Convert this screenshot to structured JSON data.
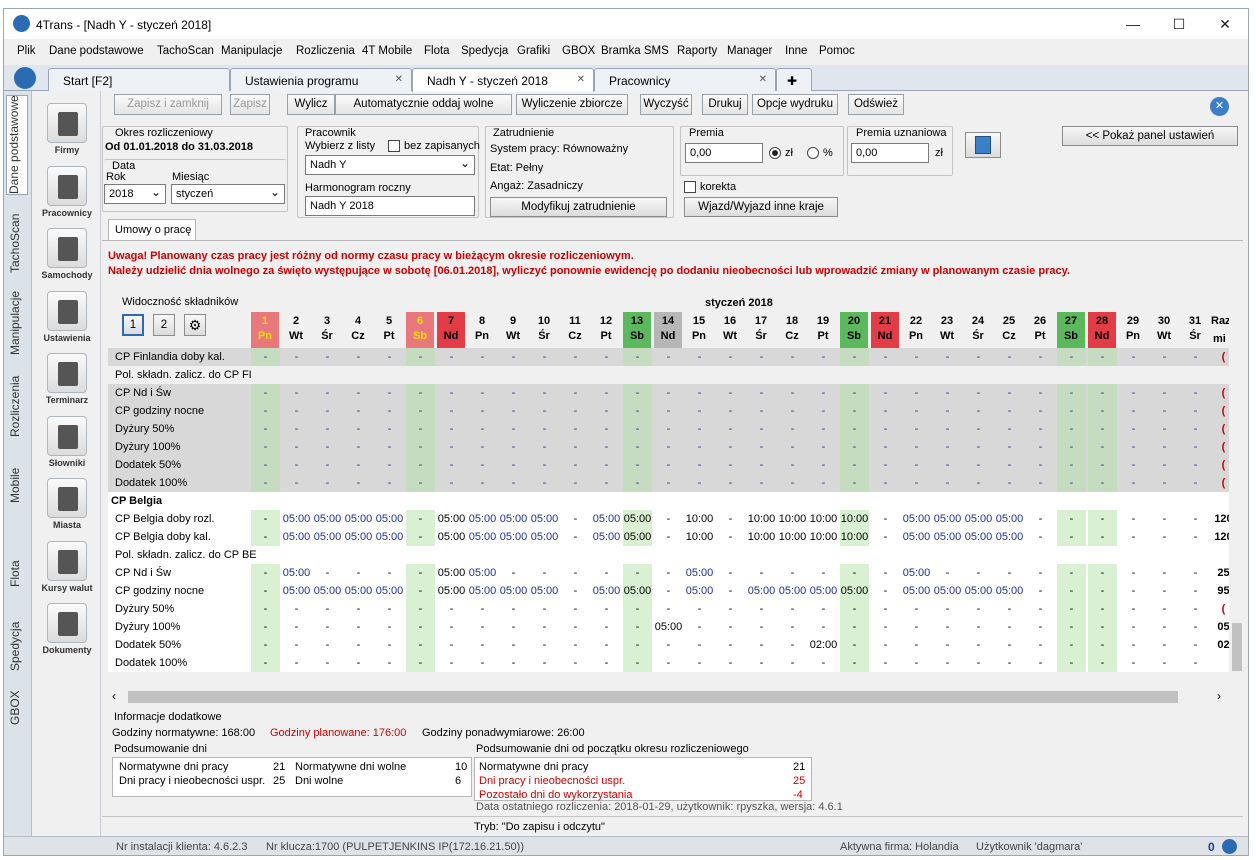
{
  "window": {
    "title": "4Trans - [Nadh Y - styczeń 2018]"
  },
  "menu": [
    "Plik",
    "Dane podstawowe",
    "TachoScan",
    "Manipulacje",
    "Rozliczenia",
    "4T Mobile",
    "Flota",
    "Spedycja",
    "Grafiki",
    "GBOX",
    "Bramka SMS",
    "Raporty",
    "Manager",
    "Inne",
    "Pomoc"
  ],
  "tabs": [
    {
      "label": "Start [F2]"
    },
    {
      "label": "Ustawienia programu"
    },
    {
      "label": "Nadh Y - styczeń 2018"
    },
    {
      "label": "Pracownicy"
    }
  ],
  "side_tabs": [
    "Dane podstawowe",
    "TachoScan",
    "Manipulacje",
    "Rozliczenia",
    "Mobile",
    "Flota",
    "Spedycja",
    "GBOX"
  ],
  "side_icons": [
    "Firmy",
    "Pracownicy",
    "Samochody",
    "Ustawienia",
    "Terminarz",
    "Słowniki",
    "Miasta",
    "Kursy walut",
    "Dokumenty"
  ],
  "toolbar": {
    "save_close": "Zapisz i zamknij",
    "save": "Zapisz",
    "compute": "Wylicz",
    "auto": "Automatycznie oddaj wolne",
    "summary": "Wyliczenie zbiorcze",
    "clear": "Wyczyść",
    "print": "Drukuj",
    "print_opts": "Opcje wydruku",
    "refresh": "Odśwież",
    "show_panel": "<< Pokaż panel ustawień"
  },
  "period": {
    "title": "Okres rozliczeniowy",
    "range": "Od  01.01.2018  do  31.03.2018",
    "data_title": "Data",
    "year_label": "Rok",
    "year": "2018",
    "month_label": "Miesiąc",
    "month": "styczeń"
  },
  "employee": {
    "title": "Pracownik",
    "choose": "Wybierz z listy",
    "without_saved": "bez zapisanych",
    "name": "Nadh Y",
    "schedule_label": "Harmonogram roczny",
    "schedule": "Nadh Y 2018"
  },
  "employment": {
    "title": "Zatrudnienie",
    "system": "System pracy: Równoważny",
    "etat": "Etat: Pełny",
    "angaz": "Angaż: Zasadniczy",
    "modify": "Modyfikuj zatrudnienie"
  },
  "bonus": {
    "title": "Premia",
    "value": "0,00",
    "zl": "zł",
    "pct": "%",
    "correction": "korekta",
    "trip": "Wjazd/Wyjazd inne kraje"
  },
  "bonus2": {
    "title": "Premia uznaniowa",
    "value": "0,00",
    "zl": "zł"
  },
  "subtab": "Umowy o pracę",
  "warnings": [
    "Uwaga! Planowany czas pracy jest różny od normy czasu pracy w bieżącym okresie rozliczeniowym.",
    "Należy udzielić dnia wolnego za święto występujące w sobotę [06.01.2018], wyliczyć ponownie ewidencję po dodaniu nieobecności lub wprowadzić zmiany w planowanym czasie pracy."
  ],
  "grid": {
    "visibility_label": "Widoczność składników",
    "month": "styczeń 2018",
    "btn1": "1",
    "btn2": "2",
    "total_top": "Raz",
    "total_bottom": "mi",
    "days": [
      {
        "n": "1",
        "d": "Pn",
        "t": "h"
      },
      {
        "n": "2",
        "d": "Wt"
      },
      {
        "n": "3",
        "d": "Śr"
      },
      {
        "n": "4",
        "d": "Cz"
      },
      {
        "n": "5",
        "d": "Pt"
      },
      {
        "n": "6",
        "d": "Sb",
        "t": "h"
      },
      {
        "n": "7",
        "d": "Nd",
        "t": "r"
      },
      {
        "n": "8",
        "d": "Pn"
      },
      {
        "n": "9",
        "d": "Wt"
      },
      {
        "n": "10",
        "d": "Śr"
      },
      {
        "n": "11",
        "d": "Cz"
      },
      {
        "n": "12",
        "d": "Pt"
      },
      {
        "n": "13",
        "d": "Sb",
        "t": "g"
      },
      {
        "n": "14",
        "d": "Nd",
        "t": "p"
      },
      {
        "n": "15",
        "d": "Pn"
      },
      {
        "n": "16",
        "d": "Wt"
      },
      {
        "n": "17",
        "d": "Śr"
      },
      {
        "n": "18",
        "d": "Cz"
      },
      {
        "n": "19",
        "d": "Pt"
      },
      {
        "n": "20",
        "d": "Sb",
        "t": "g"
      },
      {
        "n": "21",
        "d": "Nd",
        "t": "r"
      },
      {
        "n": "22",
        "d": "Pn"
      },
      {
        "n": "23",
        "d": "Wt"
      },
      {
        "n": "24",
        "d": "Śr"
      },
      {
        "n": "25",
        "d": "Cz"
      },
      {
        "n": "26",
        "d": "Pt"
      },
      {
        "n": "27",
        "d": "Sb",
        "t": "g"
      },
      {
        "n": "28",
        "d": "Nd",
        "t": "r"
      },
      {
        "n": "29",
        "d": "Pn"
      },
      {
        "n": "30",
        "d": "Wt"
      },
      {
        "n": "31",
        "d": "Śr"
      }
    ],
    "rows_fi": [
      {
        "label": "CP Finlandia doby kal.",
        "total": "(",
        "v": [
          "-",
          "-",
          "-",
          "-",
          "-",
          "-",
          "-",
          "-",
          "-",
          "-",
          "-",
          "-",
          "-",
          "-",
          "-",
          "-",
          "-",
          "-",
          "-",
          "-",
          "-",
          "-",
          "-",
          "-",
          "-",
          "-",
          "-",
          "-",
          "-",
          "-",
          "-"
        ]
      },
      {
        "label": "Pol. składn. zalicz. do CP FI",
        "section": true
      },
      {
        "label": "CP Nd i Św",
        "total": "(",
        "v": [
          "-",
          "-",
          "-",
          "-",
          "-",
          "-",
          "-",
          "-",
          "-",
          "-",
          "-",
          "-",
          "-",
          "-",
          "-",
          "-",
          "-",
          "-",
          "-",
          "-",
          "-",
          "-",
          "-",
          "-",
          "-",
          "-",
          "-",
          "-",
          "-",
          "-",
          "-"
        ]
      },
      {
        "label": "CP godziny nocne",
        "total": "(",
        "v": [
          "-",
          "-",
          "-",
          "-",
          "-",
          "-",
          "-",
          "-",
          "-",
          "-",
          "-",
          "-",
          "-",
          "-",
          "-",
          "-",
          "-",
          "-",
          "-",
          "-",
          "-",
          "-",
          "-",
          "-",
          "-",
          "-",
          "-",
          "-",
          "-",
          "-",
          "-"
        ]
      },
      {
        "label": "Dyżury 50%",
        "total": "(",
        "v": [
          "-",
          "-",
          "-",
          "-",
          "-",
          "-",
          "-",
          "-",
          "-",
          "-",
          "-",
          "-",
          "-",
          "-",
          "-",
          "-",
          "-",
          "-",
          "-",
          "-",
          "-",
          "-",
          "-",
          "-",
          "-",
          "-",
          "-",
          "-",
          "-",
          "-",
          "-"
        ]
      },
      {
        "label": "Dyżury 100%",
        "total": "(",
        "v": [
          "-",
          "-",
          "-",
          "-",
          "-",
          "-",
          "-",
          "-",
          "-",
          "-",
          "-",
          "-",
          "-",
          "-",
          "-",
          "-",
          "-",
          "-",
          "-",
          "-",
          "-",
          "-",
          "-",
          "-",
          "-",
          "-",
          "-",
          "-",
          "-",
          "-",
          "-"
        ]
      },
      {
        "label": "Dodatek 50%",
        "total": "(",
        "v": [
          "-",
          "-",
          "-",
          "-",
          "-",
          "-",
          "-",
          "-",
          "-",
          "-",
          "-",
          "-",
          "-",
          "-",
          "-",
          "-",
          "-",
          "-",
          "-",
          "-",
          "-",
          "-",
          "-",
          "-",
          "-",
          "-",
          "-",
          "-",
          "-",
          "-",
          "-"
        ]
      },
      {
        "label": "Dodatek 100%",
        "total": "(",
        "v": [
          "-",
          "-",
          "-",
          "-",
          "-",
          "-",
          "-",
          "-",
          "-",
          "-",
          "-",
          "-",
          "-",
          "-",
          "-",
          "-",
          "-",
          "-",
          "-",
          "-",
          "-",
          "-",
          "-",
          "-",
          "-",
          "-",
          "-",
          "-",
          "-",
          "-",
          "-"
        ]
      }
    ],
    "section_be": "CP Belgia",
    "rows_be": [
      {
        "label": "CP Belgia doby rozl.",
        "total": "120",
        "v": [
          "-",
          "05:00",
          "05:00",
          "05:00",
          "05:00",
          "-",
          "05:00",
          "05:00",
          "05:00",
          "05:00",
          "-",
          "05:00",
          "05:00",
          "-",
          "10:00",
          "-",
          "10:00",
          "10:00",
          "10:00",
          "10:00",
          "-",
          "05:00",
          "05:00",
          "05:00",
          "05:00",
          "-",
          "-",
          "-",
          "-",
          "-",
          "-"
        ]
      },
      {
        "label": "CP Belgia doby kal.",
        "total": "120",
        "v": [
          "-",
          "05:00",
          "05:00",
          "05:00",
          "05:00",
          "-",
          "05:00",
          "05:00",
          "05:00",
          "05:00",
          "-",
          "05:00",
          "05:00",
          "-",
          "10:00",
          "-",
          "10:00",
          "10:00",
          "10:00",
          "10:00",
          "-",
          "05:00",
          "05:00",
          "05:00",
          "05:00",
          "-",
          "-",
          "-",
          "-",
          "-",
          "-"
        ]
      },
      {
        "label": "Pol. składn. zalicz. do CP BE",
        "section": true
      },
      {
        "label": "CP Nd i Św",
        "total": "25",
        "v": [
          "-",
          "05:00",
          "-",
          "-",
          "-",
          "-",
          "05:00",
          "05:00",
          "-",
          "-",
          "-",
          "-",
          "-",
          "-",
          "05:00",
          "-",
          "-",
          "-",
          "-",
          "-",
          "-",
          "05:00",
          "-",
          "-",
          "-",
          "-",
          "-",
          "-",
          "-",
          "-",
          "-"
        ]
      },
      {
        "label": "CP godziny nocne",
        "total": "95",
        "v": [
          "-",
          "05:00",
          "05:00",
          "05:00",
          "05:00",
          "-",
          "05:00",
          "05:00",
          "05:00",
          "05:00",
          "-",
          "05:00",
          "05:00",
          "-",
          "05:00",
          "-",
          "05:00",
          "05:00",
          "05:00",
          "05:00",
          "-",
          "05:00",
          "05:00",
          "05:00",
          "05:00",
          "-",
          "-",
          "-",
          "-",
          "-",
          "-"
        ]
      },
      {
        "label": "Dyżury 50%",
        "total": "(",
        "v": [
          "-",
          "-",
          "-",
          "-",
          "-",
          "-",
          "-",
          "-",
          "-",
          "-",
          "-",
          "-",
          "-",
          "-",
          "-",
          "-",
          "-",
          "-",
          "-",
          "-",
          "-",
          "-",
          "-",
          "-",
          "-",
          "-",
          "-",
          "-",
          "-",
          "-",
          "-"
        ]
      },
      {
        "label": "Dyżury 100%",
        "total": "05",
        "v": [
          "-",
          "-",
          "-",
          "-",
          "-",
          "-",
          "-",
          "-",
          "-",
          "-",
          "-",
          "-",
          "-",
          "05:00",
          "-",
          "-",
          "-",
          "-",
          "-",
          "-",
          "-",
          "-",
          "-",
          "-",
          "-",
          "-",
          "-",
          "-",
          "-",
          "-",
          "-"
        ]
      },
      {
        "label": "Dodatek 50%",
        "total": "02",
        "v": [
          "-",
          "-",
          "-",
          "-",
          "-",
          "-",
          "-",
          "-",
          "-",
          "-",
          "-",
          "-",
          "-",
          "-",
          "-",
          "-",
          "-",
          "-",
          "02:00",
          "-",
          "-",
          "-",
          "-",
          "-",
          "-",
          "-",
          "-",
          "-",
          "-",
          "-",
          "-"
        ]
      },
      {
        "label": "Dodatek 100%",
        "total": "",
        "v": [
          "-",
          "-",
          "-",
          "-",
          "-",
          "-",
          "-",
          "-",
          "-",
          "-",
          "-",
          "-",
          "-",
          "-",
          "-",
          "-",
          "-",
          "-",
          "-",
          "-",
          "-",
          "-",
          "-",
          "-",
          "-",
          "-",
          "-",
          "-",
          "-",
          "-",
          "-"
        ]
      }
    ]
  },
  "info": {
    "title": "Informacje dodatkowe",
    "norm": "Godziny normatywne: 168:00",
    "planned": "Godziny planowane: 176:00",
    "over": "Godziny ponadwymiarowe: 26:00",
    "sum_days_title": "Podsumowanie dni",
    "sum_days": [
      [
        "Normatywne dni pracy",
        "21",
        "Normatywne dni wolne",
        "10"
      ],
      [
        "Dni pracy i nieobecności uspr.",
        "25",
        "Dni wolne",
        "6"
      ]
    ],
    "sum_period_title": "Podsumowanie dni od początku okresu rozliczeniowego",
    "sum_period": [
      [
        "Normatywne dni pracy",
        "21",
        false
      ],
      [
        "Dni pracy i nieobecności uspr.",
        "25",
        true
      ],
      [
        "Pozostało dni do wykorzystania",
        "-4",
        true
      ]
    ],
    "last": "Data ostatniego rozliczenia: 2018-01-29, użytkownik: rpyszka, wersja: 4.6.1",
    "mode": "Tryb: \"Do zapisu i odczytu\""
  },
  "status": {
    "install": "Nr instalacji klienta: 4.6.2.3",
    "key": "Nr klucza:1700 (PULPETJENKINS IP(172.16.21.50))",
    "company": "Aktywna firma: Holandia",
    "user": "Użytkownik 'dagmara'",
    "count": "0"
  },
  "colors": {
    "holiday": "#e9787c",
    "sat": "#5cb85c",
    "sun": "#e23c46",
    "dim": "#b6b6b6",
    "blue": "#1f2fa0",
    "red": "#d00000"
  }
}
